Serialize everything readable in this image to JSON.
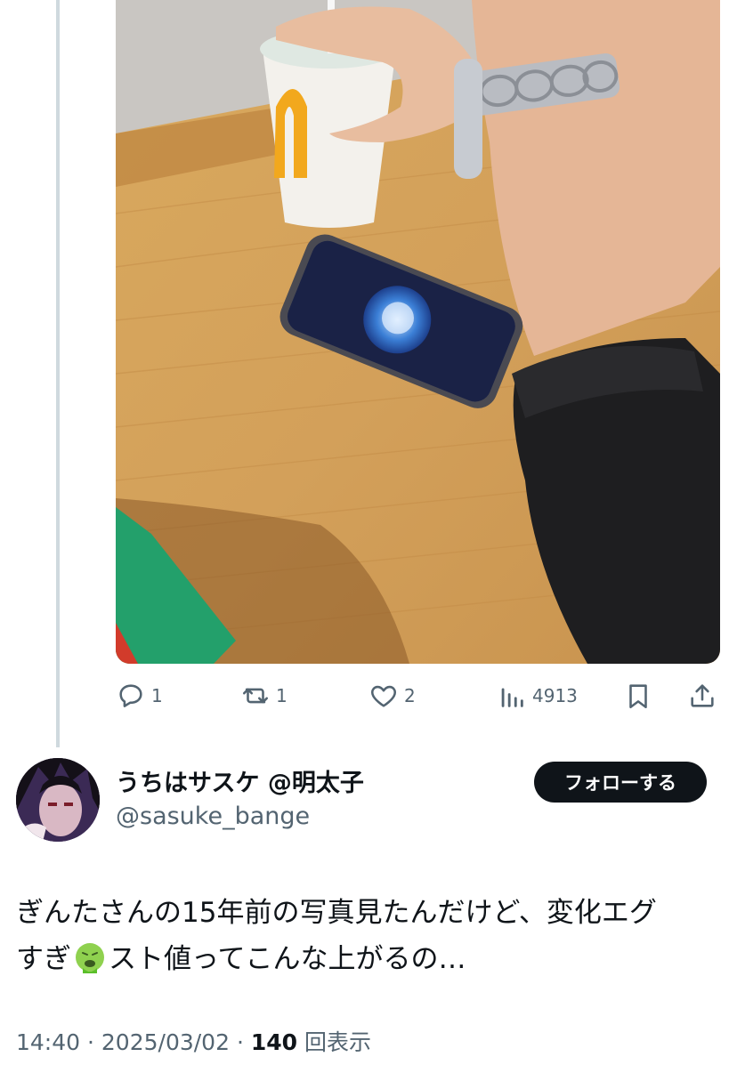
{
  "tweet": {
    "actions": {
      "reply_count": "1",
      "retweet_count": "1",
      "like_count": "2",
      "view_count": "4913"
    }
  },
  "author": {
    "display_name": "うちはサスケ @明太子",
    "handle": "@sasuke_bange",
    "follow_label": "フォローする"
  },
  "quote": {
    "text_line1": "ぎんたさんの15年前の写真見たんだけど、変化エグ",
    "text_line2_before_emoji": "すぎ",
    "emoji": "nauseated-face",
    "text_line2_after_emoji": "スト値ってこんな上がるの…",
    "time": "14:40",
    "separator": "·",
    "date": "2025/03/02",
    "views": "140",
    "views_label": "回表示"
  },
  "colors": {
    "text_primary": "#0f1419",
    "text_secondary": "#536471",
    "follow_bg": "#0f1419",
    "thread_line": "#cfd9de"
  }
}
